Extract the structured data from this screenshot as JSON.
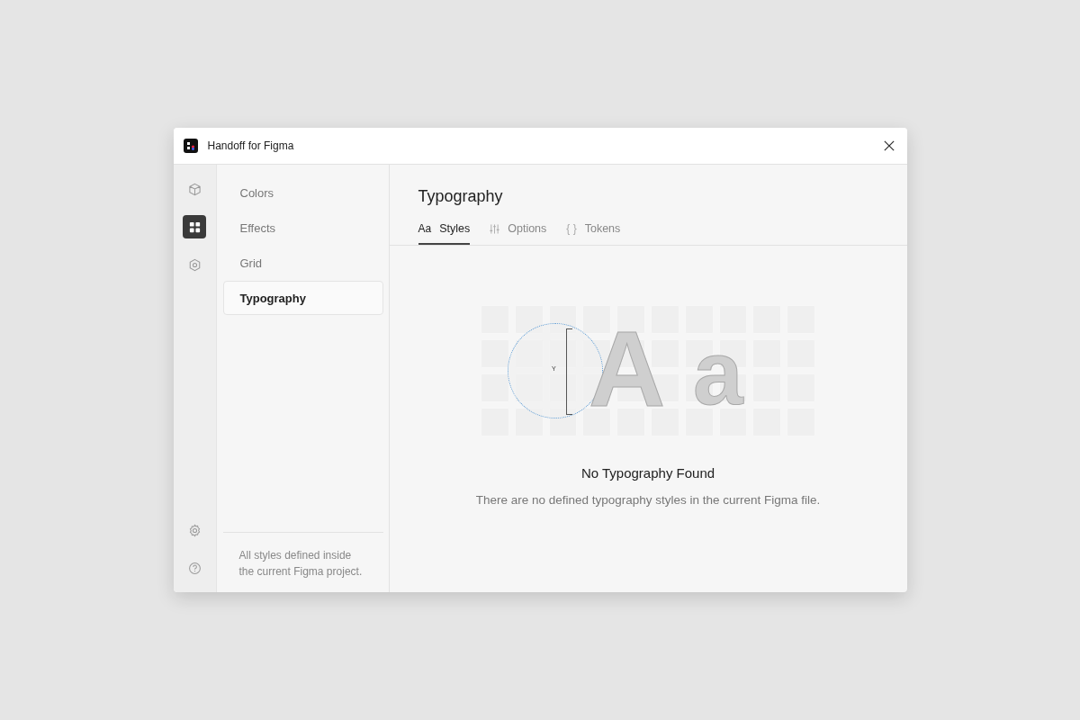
{
  "window": {
    "title": "Handoff for Figma"
  },
  "rail": {
    "top": [
      {
        "kind": "cube",
        "selected": false
      },
      {
        "kind": "grid",
        "selected": true
      },
      {
        "kind": "hexagon",
        "selected": false
      }
    ],
    "bottom": [
      {
        "kind": "gear",
        "selected": false
      },
      {
        "kind": "help",
        "selected": false
      }
    ]
  },
  "sidebar": {
    "items": [
      {
        "label": "Colors",
        "selected": false
      },
      {
        "label": "Effects",
        "selected": false
      },
      {
        "label": "Grid",
        "selected": false
      },
      {
        "label": "Typography",
        "selected": true
      }
    ],
    "footer": "All styles defined inside the current Figma project."
  },
  "main": {
    "heading": "Typography",
    "tabs": [
      {
        "icon": "Aa",
        "label": "Styles",
        "kind": "text",
        "selected": true
      },
      {
        "label": "Options",
        "kind": "sliders",
        "selected": false
      },
      {
        "icon": "{ }",
        "label": "Tokens",
        "kind": "text",
        "selected": false
      }
    ],
    "illustration": {
      "measure": "Y",
      "glyph_upper": "A",
      "glyph_lower": "a"
    },
    "empty_title": "No Typography Found",
    "empty_text": "There are no defined typography styles in the current Figma file."
  }
}
